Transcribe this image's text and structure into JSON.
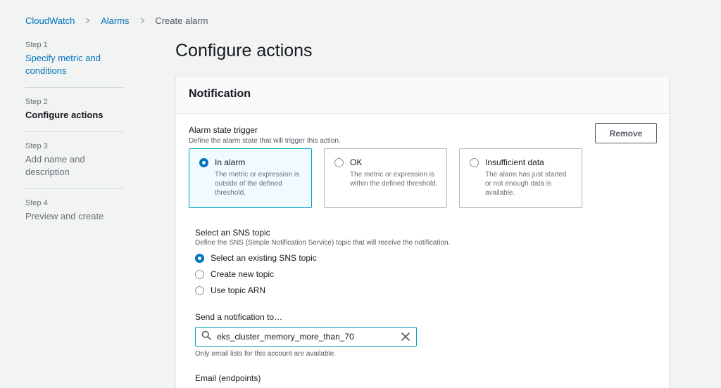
{
  "breadcrumb": {
    "items": [
      {
        "label": "CloudWatch"
      },
      {
        "label": "Alarms"
      },
      {
        "label": "Create alarm"
      }
    ]
  },
  "steps": [
    {
      "num": "Step 1",
      "label": "Specify metric and conditions",
      "state": "link"
    },
    {
      "num": "Step 2",
      "label": "Configure actions",
      "state": "active"
    },
    {
      "num": "Step 3",
      "label": "Add name and description",
      "state": "disabled"
    },
    {
      "num": "Step 4",
      "label": "Preview and create",
      "state": "disabled"
    }
  ],
  "page_title": "Configure actions",
  "notification": {
    "header": "Notification",
    "trigger_title": "Alarm state trigger",
    "trigger_desc": "Define the alarm state that will trigger this action.",
    "remove_label": "Remove",
    "tiles": [
      {
        "title": "In alarm",
        "desc": "The metric or expression is outside of the defined threshold.",
        "selected": true
      },
      {
        "title": "OK",
        "desc": "The metric or expression is within the defined threshold.",
        "selected": false
      },
      {
        "title": "Insufficient data",
        "desc": "The alarm has just started or not enough data is available.",
        "selected": false
      }
    ],
    "sns": {
      "title": "Select an SNS topic",
      "desc": "Define the SNS (Simple Notification Service) topic that will receive the notification.",
      "options": [
        {
          "label": "Select an existing SNS topic",
          "selected": true
        },
        {
          "label": "Create new topic",
          "selected": false
        },
        {
          "label": "Use topic ARN",
          "selected": false
        }
      ]
    },
    "send_label": "Send a notification to…",
    "search_value": "eks_cluster_memory_more_than_70",
    "help_text": "Only email lists for this account are available.",
    "email_label": "Email (endpoints)"
  },
  "colors": {
    "link": "#0073bb",
    "selected_border": "#00a1c9",
    "selected_bg": "#f1faff"
  }
}
